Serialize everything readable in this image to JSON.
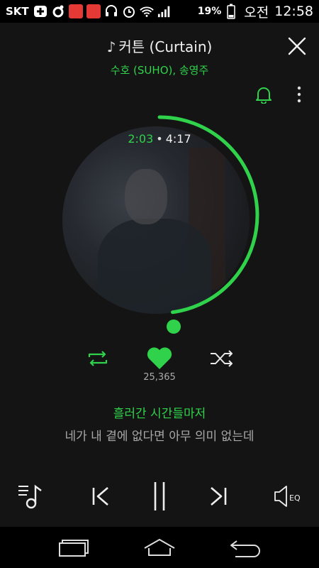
{
  "status_bar": {
    "carrier": "SKT",
    "battery": "19%",
    "ampm": "오전",
    "time": "12:58"
  },
  "player": {
    "song_title": "커튼 (Curtain)",
    "artist": "수호 (SUHO), 송영주",
    "elapsed": "2:03",
    "separator": "•",
    "duration": "4:17",
    "progress": 0.4786,
    "like_count": "25,365",
    "lyric_current": "흘러간 시간들마저",
    "lyric_next": "네가 내 곁에 없다면 아무 의미 없는데",
    "eq_label": "EQ"
  },
  "colors": {
    "accent": "#2fd24a",
    "background": "#141414",
    "text_secondary": "#a8a8a8"
  },
  "icons": {
    "close": "close-icon",
    "bell": "bell-icon",
    "more": "more-vertical-icon",
    "repeat": "repeat-icon",
    "like": "heart-icon",
    "shuffle": "shuffle-icon",
    "playlist": "playlist-icon",
    "prev": "skip-previous-icon",
    "pause": "pause-icon",
    "next": "skip-next-icon",
    "eq": "equalizer-icon"
  }
}
